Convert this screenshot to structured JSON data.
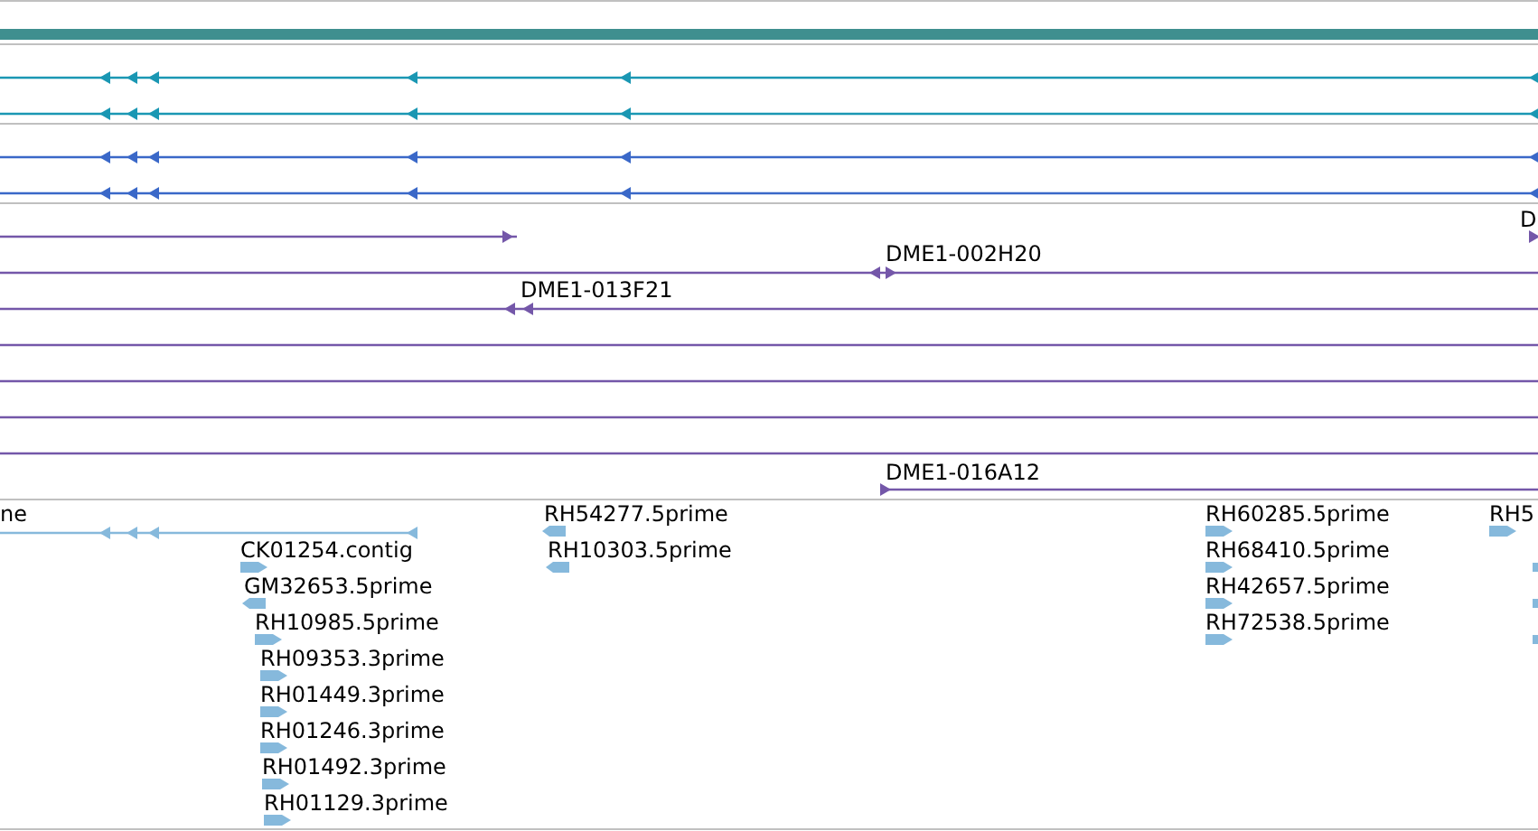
{
  "tracks": [
    {
      "kind": "transcripts",
      "color": "#1a97b3"
    },
    {
      "kind": "transcripts",
      "color": "#3a68c8"
    },
    {
      "kind": "clones",
      "color": "#7457a9",
      "features": [
        {
          "label": "D"
        },
        {
          "label": "DME1-002H20"
        },
        {
          "label": "DME1-013F21"
        },
        {
          "label": "DME1-016A12"
        }
      ]
    },
    {
      "kind": "ests",
      "color": "#86b9dc",
      "features": [
        {
          "label": "ne"
        },
        {
          "label": "CK01254.contig"
        },
        {
          "label": "GM32653.5prime"
        },
        {
          "label": "RH10985.5prime"
        },
        {
          "label": "RH09353.3prime"
        },
        {
          "label": "RH01449.3prime"
        },
        {
          "label": "RH01246.3prime"
        },
        {
          "label": "RH01492.3prime"
        },
        {
          "label": "RH01129.3prime"
        },
        {
          "label": "RH54277.5prime"
        },
        {
          "label": "RH10303.5prime"
        },
        {
          "label": "RH60285.5prime"
        },
        {
          "label": "RH68410.5prime"
        },
        {
          "label": "RH42657.5prime"
        },
        {
          "label": "RH72538.5prime"
        },
        {
          "label": "RH5"
        }
      ]
    }
  ]
}
